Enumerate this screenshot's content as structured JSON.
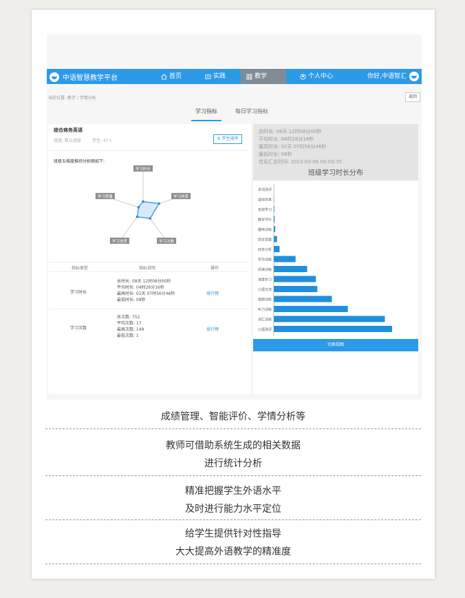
{
  "app": {
    "brand": "中语智慧教学平台",
    "nav": [
      {
        "label": "首页",
        "icon": "home-icon"
      },
      {
        "label": "实践",
        "icon": "video-icon"
      },
      {
        "label": "教学",
        "icon": "grid-icon"
      },
      {
        "label": "个人中心",
        "icon": "user-icon"
      }
    ],
    "active_nav": "教学",
    "greeting": "你好,中语智汇"
  },
  "breadcrumb": "当前位置: 教学 / 学情分析",
  "back_label": "返回",
  "tabs": [
    "学习指标",
    "每日学习指标"
  ],
  "course": {
    "title": "综合商务英语",
    "class_label": "班级: 默认班级",
    "students_label": "学生: 47人",
    "sort_label": "学生排序"
  },
  "radar": {
    "title": "班级五维度推综分析图如下:",
    "labels": [
      "学习时长",
      "学习效率",
      "学习次数",
      "学习进度",
      "学习质量"
    ],
    "values": [
      0.18,
      0.42,
      0.3,
      0.25,
      0.12
    ]
  },
  "table": {
    "headers": [
      "指标类型",
      "指标说明",
      "操作"
    ],
    "rows": [
      {
        "type": "学习时长",
        "lines": [
          "总时长: 08天 12时08分00秒",
          "平均时长: 04时26分16秒",
          "最高时长: 02天 07时56分46秒",
          "最低时长: 08秒"
        ],
        "action": "排行榜"
      },
      {
        "type": "学习次数",
        "lines": [
          "总次数: 752",
          "平均次数: 17",
          "最高次数: 149",
          "最低次数: 1"
        ],
        "action": "排行榜"
      }
    ]
  },
  "summary": [
    "总时长: 08天 12时08分00秒",
    "平均时长: 04时26分16秒",
    "最高时长: 02天 07时56分46秒",
    "最低时长: 08秒",
    "信息汇总时间: 2023-02-06 00:03:35"
  ],
  "chart_data": {
    "type": "bar",
    "orientation": "horizontal",
    "title": "班级学习时长分布",
    "categories": [
      "口语测评",
      "词汇训练",
      "听力训练",
      "视频训练",
      "口语交流",
      "课堂学习",
      "阅读训练",
      "写作训练",
      "商务分析",
      "综合竞赛",
      "趣味训练",
      "教学评价",
      "有效学习",
      "虚拟仿真",
      "单词测评"
    ],
    "values": [
      163000,
      153000,
      102000,
      80000,
      60000,
      58000,
      46000,
      30000,
      8000,
      4500,
      2000,
      1200,
      800,
      300,
      100
    ],
    "xlim": [
      0,
      180000
    ],
    "xticks": [
      "0",
      "30,000",
      "60,000",
      "90,000",
      "120,000",
      "150,000",
      "180,000"
    ],
    "color": "#1f8fe0"
  },
  "analysis_button": "切换视图",
  "captions": [
    [
      "成绩管理、智能评价、学情分析等"
    ],
    [
      "教师可借助系统生成的相关数据",
      "进行统计分析"
    ],
    [
      "精准把握学生外语水平",
      "及时进行能力水平定位"
    ],
    [
      "给学生提供针对性指导",
      "大大提高外语教学的精准度"
    ]
  ]
}
